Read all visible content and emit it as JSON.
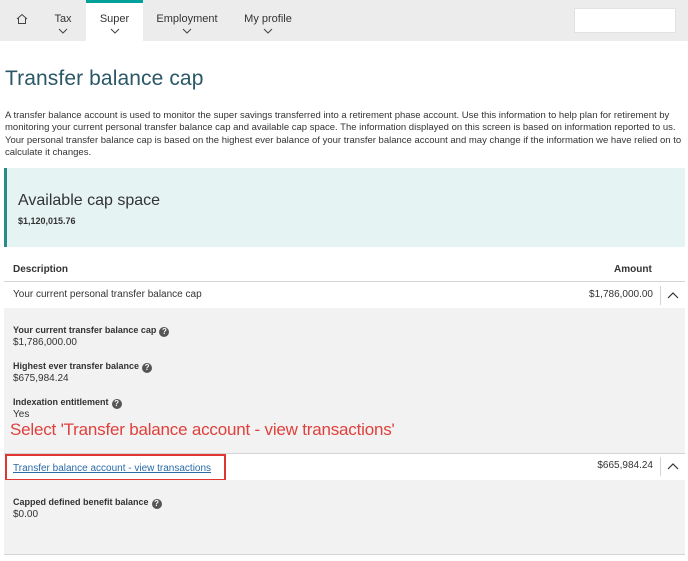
{
  "nav": {
    "tax": "Tax",
    "super": "Super",
    "employment": "Employment",
    "profile": "My profile",
    "search_placeholder": ""
  },
  "page_title": "Transfer balance cap",
  "intro": "A transfer balance account is used to monitor the super savings transferred into a retirement phase account. Use this information to help plan for retirement by monitoring your current personal transfer balance cap and available cap space. The information displayed on this screen is based on information reported to us. Your personal transfer balance cap is based on the highest ever balance of your transfer balance account and may change if the information we have relied on to calculate it changes.",
  "cap": {
    "title": "Available cap space",
    "value": "$1,120,015.76"
  },
  "table": {
    "col_description": "Description",
    "col_amount": "Amount",
    "rows": [
      {
        "description": "Your current personal transfer balance cap",
        "amount": "$1,786,000.00",
        "details": [
          {
            "label": "Your current transfer balance cap",
            "value": "$1,786,000.00"
          },
          {
            "label": "Highest ever transfer balance",
            "value": "$675,984.24"
          },
          {
            "label": "Indexation entitlement",
            "value": "Yes"
          }
        ]
      },
      {
        "description": "Transfer balance account - view transactions",
        "amount": "$665,984.24",
        "details": [
          {
            "label": "Capped defined benefit balance",
            "value": "$0.00"
          }
        ]
      }
    ]
  },
  "annotation": "Select 'Transfer balance account - view transactions'",
  "help_glyph": "?",
  "colors": {
    "accent": "#00a19a",
    "title": "#2a5866",
    "cap_panel_bg": "#e5f3f2",
    "annotation": "#e0403c",
    "link": "#2a6aa8"
  }
}
